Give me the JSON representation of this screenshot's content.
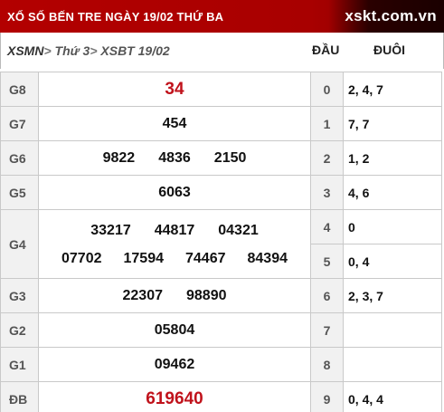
{
  "header": {
    "title": "XỔ SỐ BẾN TRE NGÀY 19/02 THỨ BA",
    "logo": "xskt.com.vn"
  },
  "breadcrumb": {
    "items": [
      "XSMN",
      "Thứ 3",
      "XSBT 19/02"
    ],
    "separator": ">"
  },
  "columns": {
    "dau": "ĐẦU",
    "duoi": "ĐUÔI"
  },
  "prizes": [
    {
      "label": "G8",
      "lines": [
        [
          "34"
        ]
      ],
      "highlight": true
    },
    {
      "label": "G7",
      "lines": [
        [
          "454"
        ]
      ],
      "highlight": false
    },
    {
      "label": "G6",
      "lines": [
        [
          "9822",
          "4836",
          "2150"
        ]
      ],
      "highlight": false
    },
    {
      "label": "G5",
      "lines": [
        [
          "6063"
        ]
      ],
      "highlight": false
    },
    {
      "label": "G4",
      "lines": [
        [
          "33217",
          "44817",
          "04321"
        ],
        [
          "07702",
          "17594",
          "74467",
          "84394"
        ]
      ],
      "highlight": false
    },
    {
      "label": "G3",
      "lines": [
        [
          "22307",
          "98890"
        ]
      ],
      "highlight": false
    },
    {
      "label": "G2",
      "lines": [
        [
          "05804"
        ]
      ],
      "highlight": false
    },
    {
      "label": "G1",
      "lines": [
        [
          "09462"
        ]
      ],
      "highlight": false
    },
    {
      "label": "ĐB",
      "lines": [
        [
          "619640"
        ]
      ],
      "highlight": true
    }
  ],
  "loto": [
    {
      "dau": "0",
      "duoi": "2, 4, 7"
    },
    {
      "dau": "1",
      "duoi": "7, 7"
    },
    {
      "dau": "2",
      "duoi": "1, 2"
    },
    {
      "dau": "3",
      "duoi": "4, 6"
    },
    {
      "dau": "4",
      "duoi": "0"
    },
    {
      "dau": "5",
      "duoi": "0, 4"
    },
    {
      "dau": "6",
      "duoi": "2, 3, 7"
    },
    {
      "dau": "7",
      "duoi": ""
    },
    {
      "dau": "8",
      "duoi": ""
    },
    {
      "dau": "9",
      "duoi": "0, 4, 4"
    }
  ],
  "colors": {
    "header_bg": "#b30000",
    "prize_highlight": "#c0121b",
    "label_bg": "#f1f1f1"
  }
}
